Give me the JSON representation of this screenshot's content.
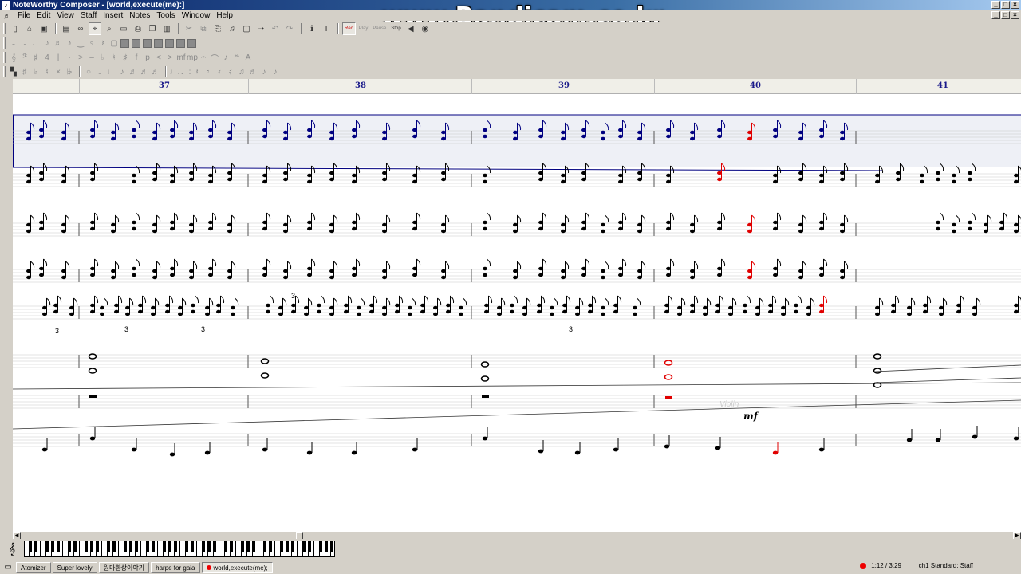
{
  "window": {
    "title": "NoteWorthy Composer - [world,execute(me):]",
    "controls": [
      "_",
      "□",
      "×"
    ]
  },
  "watermark": "www.Bandicam.co.kr",
  "menu": [
    "File",
    "Edit",
    "View",
    "Staff",
    "Insert",
    "Notes",
    "Tools",
    "Window",
    "Help"
  ],
  "toolbar1": {
    "rec_label": "Rec",
    "play_label": "Play",
    "pause_label": "Pause",
    "stop_label": "Stop"
  },
  "ruler": {
    "measures": [
      "37",
      "38",
      "39",
      "40",
      "41"
    ]
  },
  "score": {
    "text_marks": {
      "triplet": "3",
      "dynamic": "mf",
      "instrument_ghost": "Violin"
    }
  },
  "taskbar": {
    "tasks": [
      "Atomizer",
      "Super lovely",
      "원마환상이야기",
      "harpe for gaia",
      "world,execute(me);"
    ],
    "active_task": "world,execute(me);",
    "time": "1:12 / 3:29",
    "staff_status": "ch1 Standard: Staff"
  },
  "colors": {
    "selected_staff": "#000080",
    "highlight_note": "#e00000",
    "title_gradient_start": "#0a246a"
  }
}
